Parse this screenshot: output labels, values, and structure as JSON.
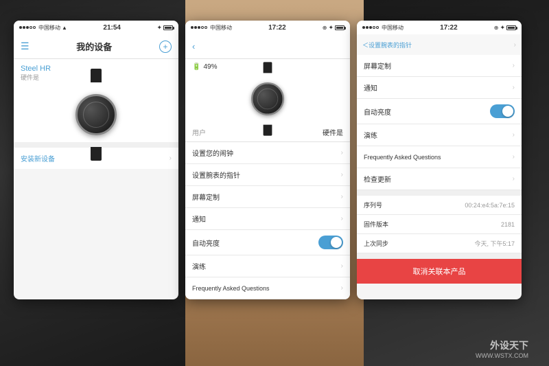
{
  "background": {
    "keyboard_color": "#222",
    "hand_color": "#c9a882",
    "right_color": "#1a1a1a"
  },
  "watermark": {
    "site": "WWW.WSTX.COM",
    "logo": "外设天下"
  },
  "screen1": {
    "status": {
      "carrier": "中国移动",
      "time": "21:54",
      "wifi": "wifi",
      "bluetooth": "bt"
    },
    "title": "我的设备",
    "add_button": "+",
    "device": {
      "name": "Steel HR",
      "subtitle": "硬件是"
    },
    "install_label": "安装新设备",
    "sections": []
  },
  "screen2": {
    "status": {
      "carrier": "中国移动",
      "time": "17:22"
    },
    "back_label": "＜",
    "battery": "49%",
    "user_label": "用户",
    "hardware_label": "硬件是",
    "menu_items": [
      {
        "label": "设置您的闹钟",
        "has_chevron": true
      },
      {
        "label": "设置腕表的指针",
        "has_chevron": true
      },
      {
        "label": "屏幕定制",
        "has_chevron": true
      },
      {
        "label": "通知",
        "has_chevron": true
      },
      {
        "label": "自动亮度",
        "has_toggle": true
      },
      {
        "label": "演练",
        "has_chevron": true
      },
      {
        "label": "Frequently Asked Questions",
        "has_chevron": true
      }
    ]
  },
  "screen3": {
    "status": {
      "carrier": "中国移动",
      "time": "17:22"
    },
    "back_label": "＜设置腕表的指针",
    "forward_label": "›",
    "menu_items": [
      {
        "label": "屏幕定制",
        "has_chevron": true
      },
      {
        "label": "通知",
        "has_chevron": true
      },
      {
        "label": "自动亮度",
        "has_toggle": true
      },
      {
        "label": "演练",
        "has_chevron": true
      },
      {
        "label": "Frequently Asked Questions",
        "has_chevron": true
      },
      {
        "label": "检查更新",
        "has_chevron": true
      }
    ],
    "info_rows": [
      {
        "key": "序列号",
        "value": "00:24:e4:5a:7e:15"
      },
      {
        "key": "固件版本",
        "value": "2181"
      },
      {
        "key": "上次同步",
        "value": "今天, 下午5:17"
      }
    ],
    "cancel_button": "取消关联本产品"
  }
}
